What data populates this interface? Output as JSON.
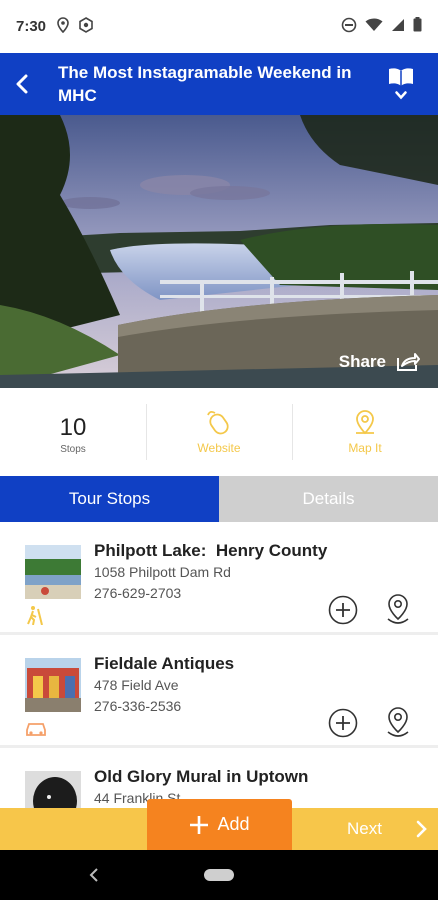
{
  "status_bar": {
    "time": "7:30",
    "icons": [
      "location-icon",
      "settings-icon",
      "dnd-icon",
      "wifi-icon",
      "signal-icon",
      "battery-icon"
    ]
  },
  "app_bar": {
    "title": "The Most Instagramable Weekend in MHC",
    "color": "#1040c4"
  },
  "hero": {
    "share_label": "Share"
  },
  "stats": {
    "stops_count": "10",
    "stops_label": "Stops",
    "website_label": "Website",
    "map_label": "Map It",
    "accent": "#f4c84a"
  },
  "tabs": [
    {
      "label": "Tour Stops",
      "active": true
    },
    {
      "label": "Details",
      "active": false
    }
  ],
  "stops": [
    {
      "title": "Philpott Lake:  Henry County",
      "address": "1058 Philpott Dam Rd",
      "phone": "276-629-2703",
      "category_icon": "hiker-icon"
    },
    {
      "title": "Fieldale Antiques",
      "address": "478 Field Ave",
      "phone": "276-336-2536",
      "category_icon": "car-icon"
    },
    {
      "title": "Old Glory Mural in Uptown",
      "address": "44 Franklin St",
      "phone": "",
      "category_icon": ""
    }
  ],
  "bottom_bar": {
    "add_label": "Add",
    "next_label": "Next",
    "add_color": "#f5831f",
    "bar_color": "#f7c64a"
  }
}
